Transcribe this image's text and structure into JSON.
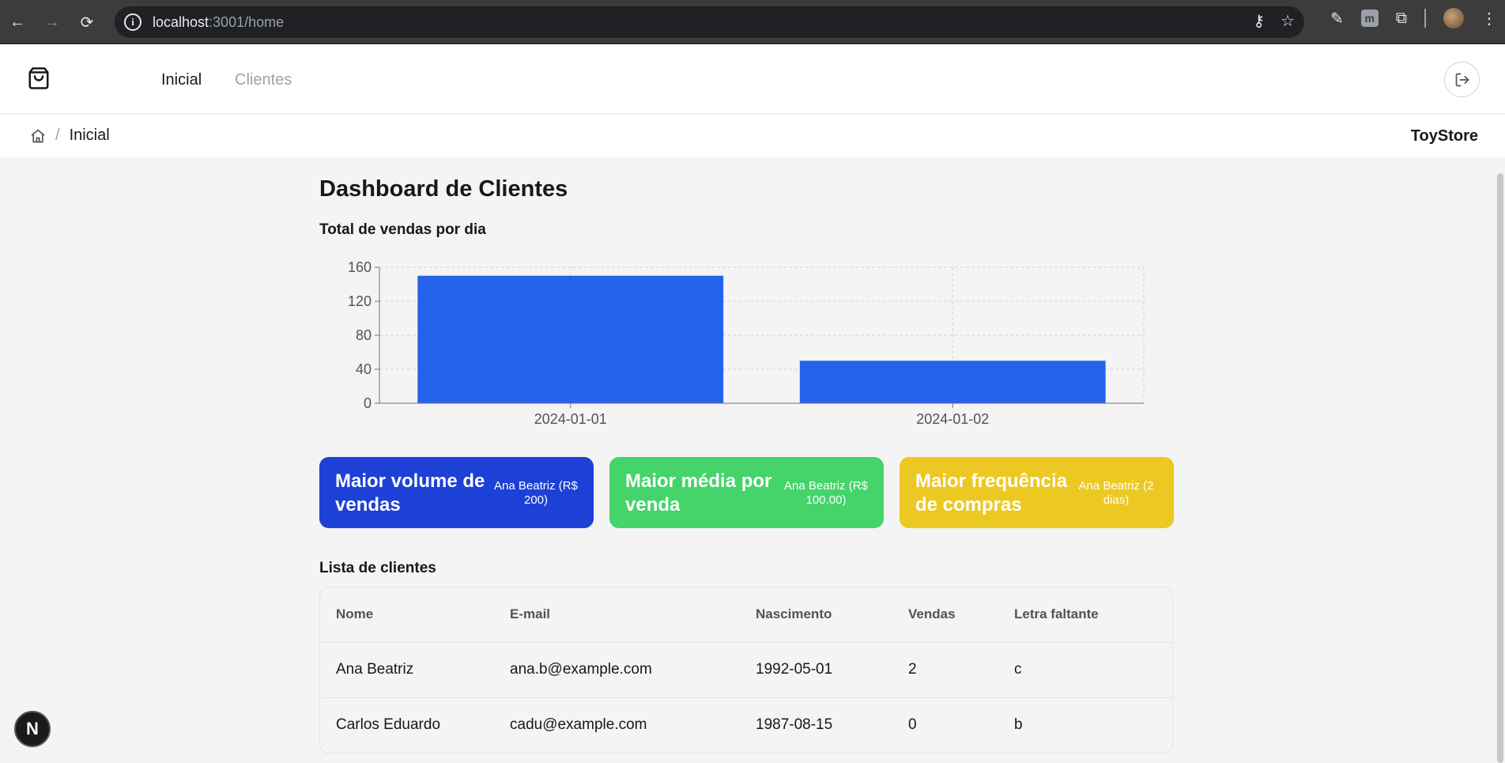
{
  "browser": {
    "url_host": "localhost",
    "url_path": ":3001/home"
  },
  "header": {
    "nav": [
      {
        "label": "Inicial",
        "active": true
      },
      {
        "label": "Clientes",
        "active": false
      }
    ]
  },
  "breadcrumb": {
    "separator": "/",
    "current": "Inicial",
    "store": "ToyStore"
  },
  "main": {
    "title": "Dashboard de Clientes",
    "chart_title": "Total de vendas por dia"
  },
  "chart_data": {
    "type": "bar",
    "categories": [
      "2024-01-01",
      "2024-01-02"
    ],
    "values": [
      150,
      50
    ],
    "ylim": [
      0,
      160
    ],
    "yticks": [
      0,
      40,
      80,
      120,
      160
    ],
    "grid": true,
    "colors": {
      "bar": "#2563eb"
    }
  },
  "cards": [
    {
      "title": "Maior volume de vendas",
      "value": "Ana Beatriz (R$ 200)",
      "color": "#1d40d6"
    },
    {
      "title": "Maior média por venda",
      "value": "Ana Beatriz (R$ 100.00)",
      "color": "#44d46a"
    },
    {
      "title": "Maior frequência de compras",
      "value": "Ana Beatriz (2 dias)",
      "color": "#ecc822"
    }
  ],
  "clients": {
    "title": "Lista de clientes",
    "columns": [
      "Nome",
      "E-mail",
      "Nascimento",
      "Vendas",
      "Letra faltante"
    ],
    "rows": [
      [
        "Ana Beatriz",
        "ana.b@example.com",
        "1992-05-01",
        "2",
        "c"
      ],
      [
        "Carlos Eduardo",
        "cadu@example.com",
        "1987-08-15",
        "0",
        "b"
      ]
    ]
  },
  "badge": {
    "label": "N"
  }
}
